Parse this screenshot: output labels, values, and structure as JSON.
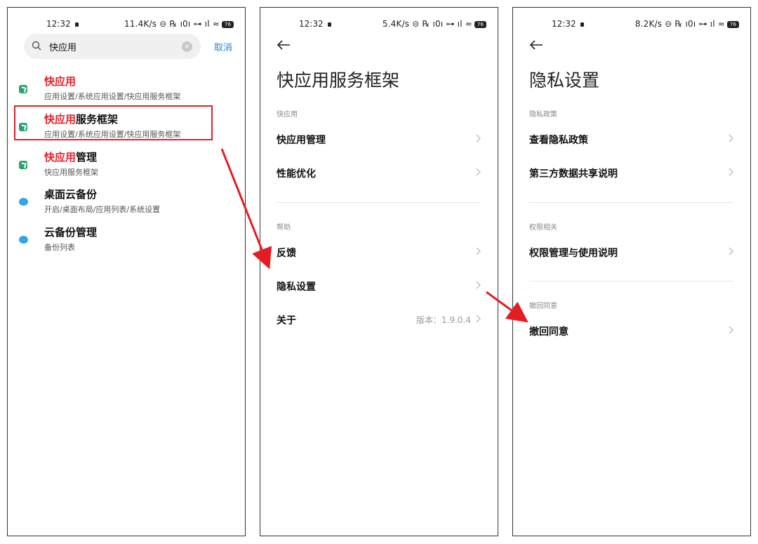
{
  "status": {
    "time": "12:32",
    "screens": [
      {
        "speed": "11.4K/s"
      },
      {
        "speed": "5.4K/s"
      },
      {
        "speed": "8.2K/s"
      }
    ],
    "icons": "⊝ ℞ ı0ı ⊶ ıl ≈",
    "battery": "76"
  },
  "search": {
    "query": "快应用",
    "cancel_label": "取消"
  },
  "results": [
    {
      "hl": "快应用",
      "rest": "",
      "sub": "应用设置/系统应用设置/快应用服务框架",
      "icon": "green-app-icon"
    },
    {
      "hl": "快应用",
      "rest": "服务框架",
      "sub": "应用设置/系统应用设置/快应用服务框架",
      "icon": "green-app-icon"
    },
    {
      "hl": "快应用",
      "rest": "管理",
      "sub": "快应用服务框架",
      "icon": "green-app-icon"
    },
    {
      "hl": "",
      "rest": "桌面云备份",
      "sub": "开启/桌面布局/应用列表/系统设置",
      "icon": "cloud-icon"
    },
    {
      "hl": "",
      "rest": "云备份管理",
      "sub": "备份列表",
      "icon": "cloud-icon"
    }
  ],
  "framework": {
    "title": "快应用服务框架",
    "section1": "快应用",
    "items1": [
      "快应用管理",
      "性能优化"
    ],
    "section2": "帮助",
    "items2": [
      "反馈",
      "隐私设置",
      "关于"
    ],
    "version": "版本：1.9.0.4"
  },
  "privacy": {
    "title": "隐私设置",
    "section1": "隐私政策",
    "items1": [
      "查看隐私政策",
      "第三方数据共享说明"
    ],
    "section2": "权限相关",
    "items2": [
      "权限管理与使用说明"
    ],
    "section3": "撤回同意",
    "items3": [
      "撤回同意"
    ]
  },
  "colors": {
    "highlight": "#e8202a",
    "accent": "#1e88e5",
    "annotation": "#e51c23"
  }
}
